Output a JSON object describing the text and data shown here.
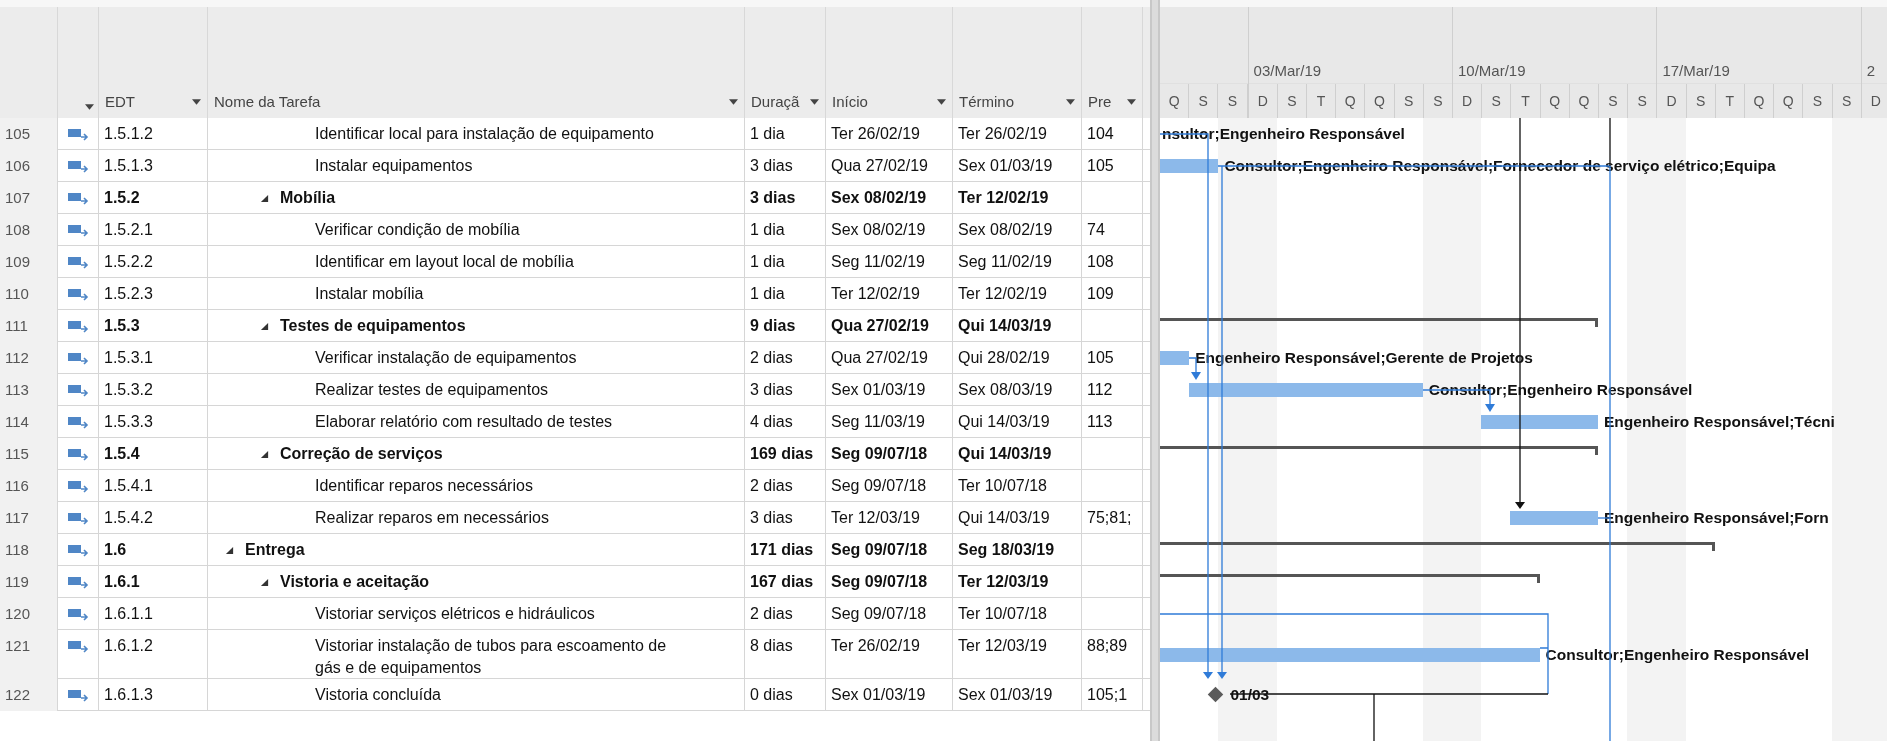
{
  "columns": [
    {
      "label": "EDT"
    },
    {
      "label": "Nome da Tarefa"
    },
    {
      "label": "Duraçã"
    },
    {
      "label": "Início"
    },
    {
      "label": "Término"
    },
    {
      "label": "Pre"
    }
  ],
  "timescale": {
    "weeks": [
      {
        "days": [
          "Q",
          "S",
          "S"
        ]
      },
      {
        "label": "03/Mar/19",
        "days": [
          "D",
          "S",
          "T",
          "Q",
          "Q",
          "S",
          "S"
        ]
      },
      {
        "label": "10/Mar/19",
        "days": [
          "D",
          "S",
          "T",
          "Q",
          "Q",
          "S",
          "S"
        ]
      },
      {
        "label": "17/Mar/19",
        "days": [
          "D",
          "S",
          "T",
          "Q",
          "Q",
          "S",
          "S"
        ]
      },
      {
        "label": "2",
        "days": [
          "D"
        ]
      }
    ]
  },
  "tasks": [
    {
      "id": "105",
      "wbs": "1.5.1.2",
      "name": "Identificar local para instalação de equipamento",
      "duration": "1 dia",
      "start": "Ter 26/02/19",
      "finish": "Ter 26/02/19",
      "predecessors": "104",
      "kind": "task",
      "resources": "nsultor;Engenheiro Responsável"
    },
    {
      "id": "106",
      "wbs": "1.5.1.3",
      "name": "Instalar equipamentos",
      "duration": "3 dias",
      "start": "Qua 27/02/19",
      "finish": "Sex 01/03/19",
      "predecessors": "105",
      "kind": "task",
      "resources": "Consultor;Engenheiro Responsável;Fornecedor de serviço elétrico;Equipa"
    },
    {
      "id": "107",
      "wbs": "1.5.2",
      "name": "Mobília",
      "duration": "3 dias",
      "start": "Sex 08/02/19",
      "finish": "Ter 12/02/19",
      "kind": "summary",
      "expanded": true,
      "children": [
        {
          "id": "108",
          "wbs": "1.5.2.1",
          "name": "Verificar condição de mobília",
          "duration": "1 dia",
          "start": "Sex 08/02/19",
          "finish": "Sex 08/02/19",
          "predecessors": "74",
          "kind": "task"
        },
        {
          "id": "109",
          "wbs": "1.5.2.2",
          "name": "Identificar em layout local de mobília",
          "duration": "1 dia",
          "start": "Seg 11/02/19",
          "finish": "Seg 11/02/19",
          "predecessors": "108",
          "kind": "task"
        },
        {
          "id": "110",
          "wbs": "1.5.2.3",
          "name": "Instalar mobília",
          "duration": "1 dia",
          "start": "Ter 12/02/19",
          "finish": "Ter 12/02/19",
          "predecessors": "109",
          "kind": "task"
        }
      ]
    },
    {
      "id": "111",
      "wbs": "1.5.3",
      "name": "Testes de equipamentos",
      "duration": "9 dias",
      "start": "Qua 27/02/19",
      "finish": "Qui 14/03/19",
      "kind": "summary",
      "expanded": true,
      "children": [
        {
          "id": "112",
          "wbs": "1.5.3.1",
          "name": "Verificar instalação de equipamentos",
          "duration": "2 dias",
          "start": "Qua 27/02/19",
          "finish": "Qui 28/02/19",
          "predecessors": "105",
          "kind": "task",
          "resources": "Engenheiro Responsável;Gerente de Projetos"
        },
        {
          "id": "113",
          "wbs": "1.5.3.2",
          "name": "Realizar testes de equipamentos",
          "duration": "3 dias",
          "start": "Sex 01/03/19",
          "finish": "Sex 08/03/19",
          "predecessors": "112",
          "kind": "task",
          "resources": "Consultor;Engenheiro Responsável"
        },
        {
          "id": "114",
          "wbs": "1.5.3.3",
          "name": "Elaborar relatório com resultado de testes",
          "duration": "4 dias",
          "start": "Seg 11/03/19",
          "finish": "Qui 14/03/19",
          "predecessors": "113",
          "kind": "task",
          "resources": "Engenheiro Responsável;Técni"
        }
      ]
    },
    {
      "id": "115",
      "wbs": "1.5.4",
      "name": "Correção de serviços",
      "duration": "169 dias",
      "start": "Seg 09/07/18",
      "finish": "Qui 14/03/19",
      "kind": "summary",
      "expanded": true,
      "children": [
        {
          "id": "116",
          "wbs": "1.5.4.1",
          "name": "Identificar reparos necessários",
          "duration": "2 dias",
          "start": "Seg 09/07/18",
          "finish": "Ter 10/07/18",
          "kind": "task"
        },
        {
          "id": "117",
          "wbs": "1.5.4.2",
          "name": "Realizar reparos em necessários",
          "duration": "3 dias",
          "start": "Ter 12/03/19",
          "finish": "Qui 14/03/19",
          "predecessors": "75;81;",
          "kind": "task",
          "resources": "Engenheiro Responsável;Forn"
        }
      ]
    },
    {
      "id": "118",
      "wbs": "1.6",
      "name": "Entrega",
      "duration": "171 dias",
      "start": "Seg 09/07/18",
      "finish": "Seg 18/03/19",
      "kind": "summary",
      "expanded": true,
      "children": [
        {
          "id": "119",
          "wbs": "1.6.1",
          "name": "Vistoria e aceitação",
          "duration": "167 dias",
          "start": "Seg 09/07/18",
          "finish": "Ter 12/03/19",
          "kind": "summary",
          "expanded": true,
          "children": [
            {
              "id": "120",
              "wbs": "1.6.1.1",
              "name": "Vistoriar serviços elétricos e hidráulicos",
              "duration": "2 dias",
              "start": "Seg 09/07/18",
              "finish": "Ter 10/07/18",
              "kind": "task"
            },
            {
              "id": "121",
              "wbs": "1.6.1.2",
              "name": "Vistoriar instalação de tubos para escoamento de gás e de equipamentos",
              "duration": "8 dias",
              "start": "Ter 26/02/19",
              "finish": "Ter 12/03/19",
              "predecessors": "88;89",
              "kind": "task",
              "resources": "Consultor;Engenheiro Responsável"
            },
            {
              "id": "122",
              "wbs": "1.6.1.3",
              "name": "Vistoria concluída",
              "duration": "0 dias",
              "start": "Sex 01/03/19",
              "finish": "Sex 01/03/19",
              "predecessors": "105;1",
              "kind": "milestone",
              "resources": "01/03"
            }
          ]
        }
      ]
    }
  ]
}
